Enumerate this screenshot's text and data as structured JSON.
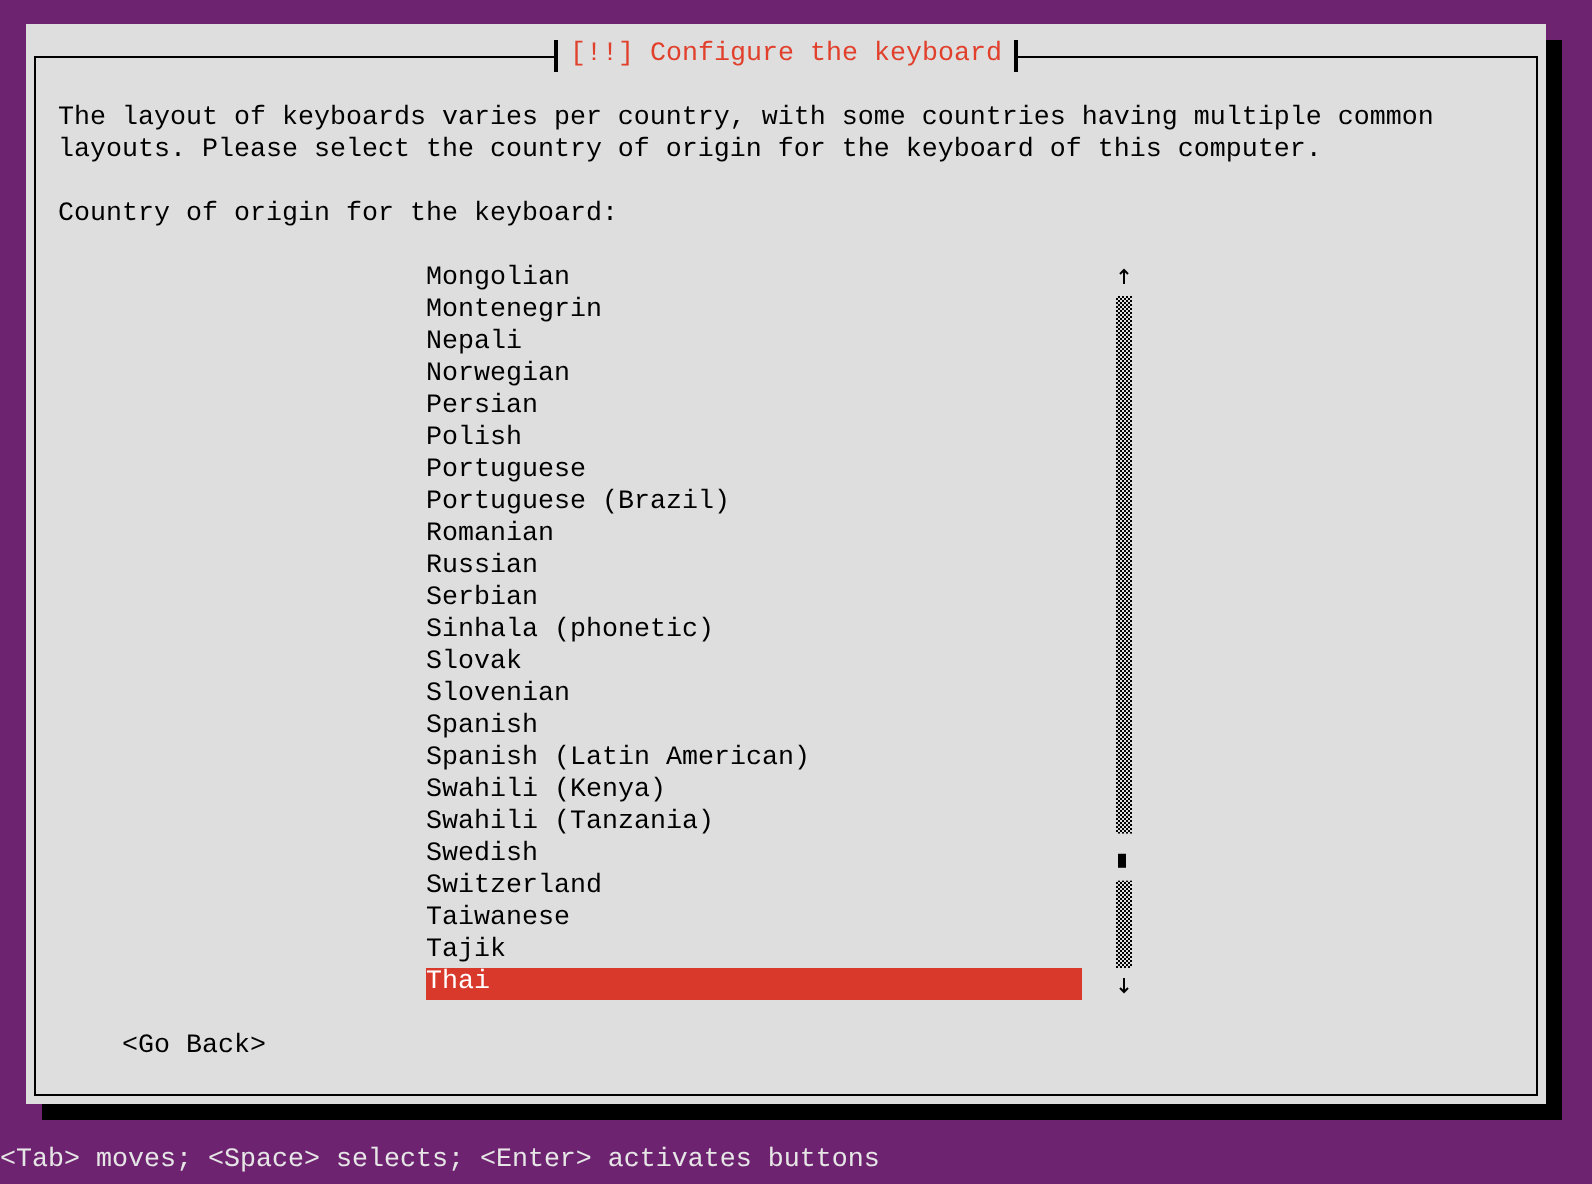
{
  "dialog": {
    "title": "[!!] Configure the keyboard",
    "description": "The layout of keyboards varies per country, with some countries having multiple common layouts. Please select the country of origin for the keyboard of this computer.",
    "prompt": "Country of origin for the keyboard:",
    "items": [
      {
        "label": "Mongolian",
        "selected": false
      },
      {
        "label": "Montenegrin",
        "selected": false
      },
      {
        "label": "Nepali",
        "selected": false
      },
      {
        "label": "Norwegian",
        "selected": false
      },
      {
        "label": "Persian",
        "selected": false
      },
      {
        "label": "Polish",
        "selected": false
      },
      {
        "label": "Portuguese",
        "selected": false
      },
      {
        "label": "Portuguese (Brazil)",
        "selected": false
      },
      {
        "label": "Romanian",
        "selected": false
      },
      {
        "label": "Russian",
        "selected": false
      },
      {
        "label": "Serbian",
        "selected": false
      },
      {
        "label": "Sinhala (phonetic)",
        "selected": false
      },
      {
        "label": "Slovak",
        "selected": false
      },
      {
        "label": "Slovenian",
        "selected": false
      },
      {
        "label": "Spanish",
        "selected": false
      },
      {
        "label": "Spanish (Latin American)",
        "selected": false
      },
      {
        "label": "Swahili (Kenya)",
        "selected": false
      },
      {
        "label": "Swahili (Tanzania)",
        "selected": false
      },
      {
        "label": "Swedish",
        "selected": false
      },
      {
        "label": "Switzerland",
        "selected": false
      },
      {
        "label": "Taiwanese",
        "selected": false
      },
      {
        "label": "Tajik",
        "selected": false
      },
      {
        "label": "Thai",
        "selected": true
      }
    ],
    "buttons": [
      {
        "label": "<Go Back>"
      }
    ]
  },
  "status_bar": "<Tab> moves; <Space> selects; <Enter> activates buttons"
}
